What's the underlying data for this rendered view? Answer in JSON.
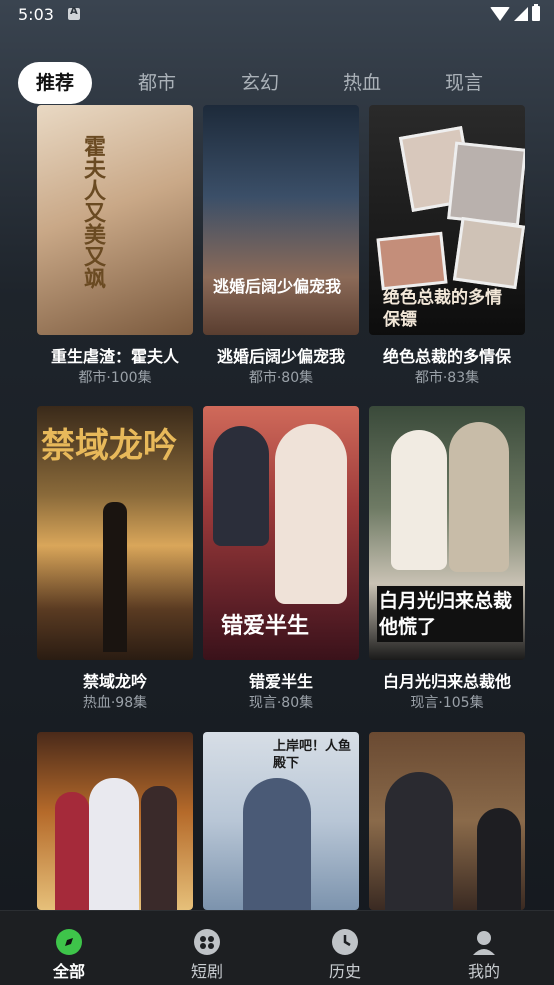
{
  "status": {
    "time": "5:03"
  },
  "tabs": [
    "推荐",
    "都市",
    "玄幻",
    "热血",
    "现言"
  ],
  "cards": [
    {
      "title": "重生虐渣：霍夫人",
      "meta": "都市·100集",
      "poster_text": "霍夫人又美又飒"
    },
    {
      "title": "逃婚后阔少偏宠我",
      "meta": "都市·80集",
      "poster_text": "逃婚后阔少偏宠我"
    },
    {
      "title": "绝色总裁的多情保",
      "meta": "都市·83集",
      "poster_text": "绝色总裁的多情保镖"
    },
    {
      "title": "禁域龙吟",
      "meta": "热血·98集",
      "poster_text": "禁域龙吟"
    },
    {
      "title": "错爱半生",
      "meta": "现言·80集",
      "poster_text": "错爱半生"
    },
    {
      "title": "白月光归来总裁他",
      "meta": "现言·105集",
      "poster_text": "白月光归来总裁他慌了"
    },
    {
      "title": "",
      "meta": "",
      "poster_text": ""
    },
    {
      "title": "",
      "meta": "",
      "poster_text": "上岸吧！人鱼殿下"
    },
    {
      "title": "",
      "meta": "",
      "poster_text": ""
    }
  ],
  "bottom_nav": [
    {
      "label": "全部",
      "icon": "compass-icon"
    },
    {
      "label": "短剧",
      "icon": "film-reel-icon"
    },
    {
      "label": "历史",
      "icon": "clock-icon"
    },
    {
      "label": "我的",
      "icon": "person-icon"
    }
  ],
  "colors": {
    "accent": "#3ec44a",
    "background": "#15191e"
  }
}
